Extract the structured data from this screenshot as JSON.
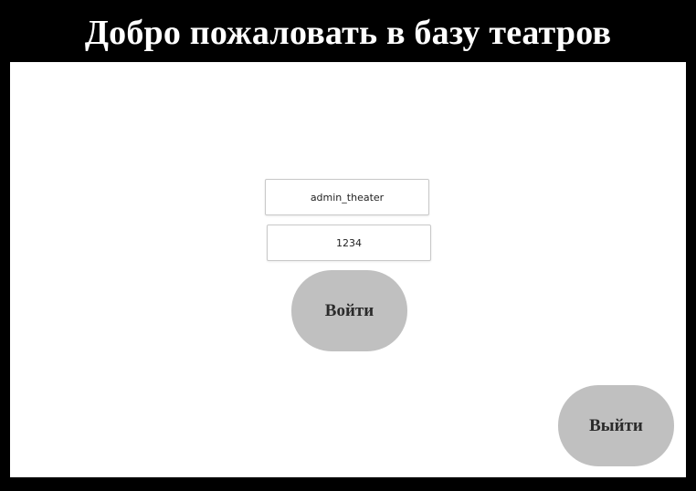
{
  "header": {
    "title": "Добро пожаловать в базу театров"
  },
  "form": {
    "login_value": "admin_theater",
    "password_value": "1234",
    "login_button_label": "Войти"
  },
  "footer": {
    "exit_button_label": "Выйти"
  },
  "colors": {
    "frame_background": "#000000",
    "content_background": "#ffffff",
    "button_background": "#c0c0c0",
    "title_text": "#ffffff"
  }
}
